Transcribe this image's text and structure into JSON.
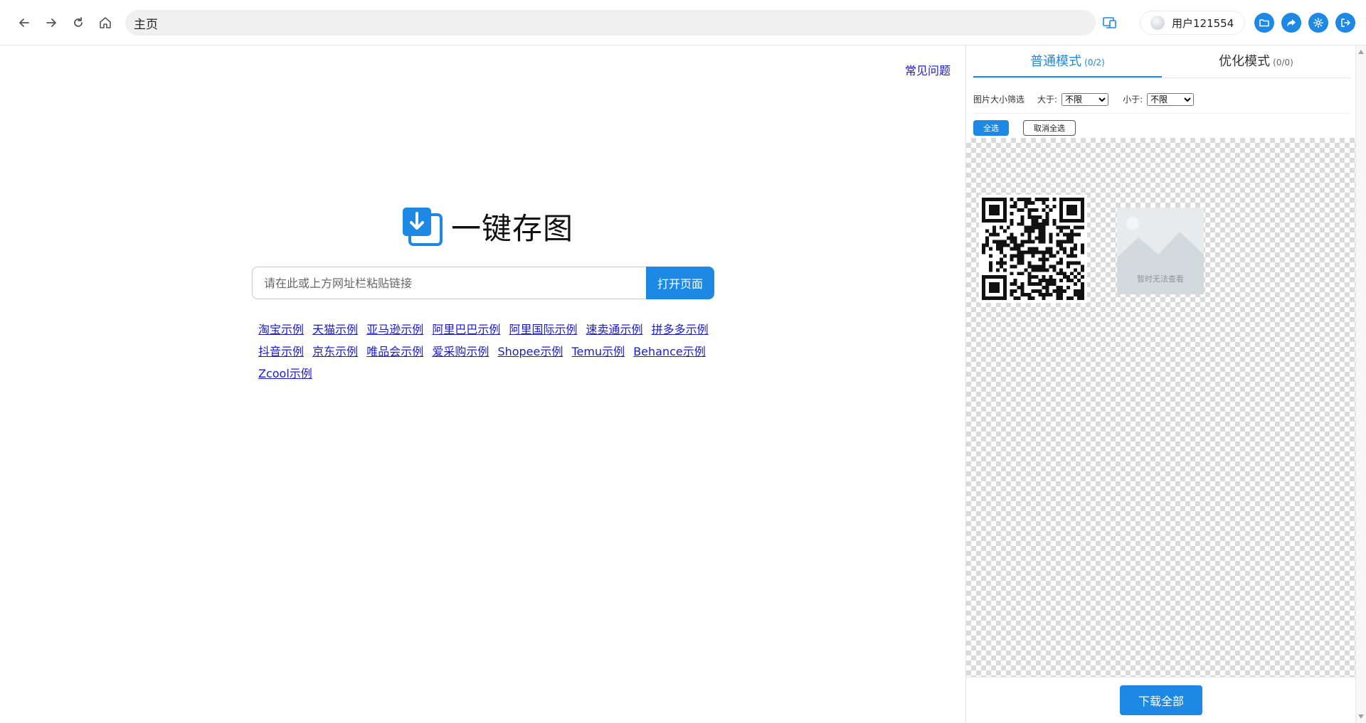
{
  "toolbar": {
    "address_text": "主页",
    "user_name": "用户121554",
    "icons": {
      "back": "arrow-left-icon",
      "forward": "arrow-right-icon",
      "reload": "reload-icon",
      "home": "home-icon",
      "screen": "screen-switch-icon",
      "folder": "folder-icon",
      "share": "share-icon",
      "settings": "gear-icon",
      "logout": "logout-icon"
    },
    "accent_color": "#1e88e5"
  },
  "main": {
    "faq_link": "常见问题",
    "logo_text": "一键存图",
    "search": {
      "placeholder": "请在此或上方网址栏粘贴链接",
      "value": "",
      "button": "打开页面"
    },
    "examples": [
      "淘宝示例",
      "天猫示例",
      "亚马逊示例",
      "阿里巴巴示例",
      "阿里国际示例",
      "速卖通示例",
      "拼多多示例",
      "抖音示例",
      "京东示例",
      "唯品会示例",
      "爱采购示例",
      "Shopee示例",
      "Temu示例",
      "Behance示例",
      "Zcool示例"
    ]
  },
  "panel": {
    "tabs": [
      {
        "label": "普通模式",
        "count": "(0/2)",
        "active": true
      },
      {
        "label": "优化模式",
        "count": "(0/0)",
        "active": false
      }
    ],
    "filter": {
      "label": "图片大小筛选",
      "min_label": "大于:",
      "min_value": "不限",
      "max_label": "小于:",
      "max_value": "不限"
    },
    "select_all": "全选",
    "deselect_all": "取消全选",
    "placeholder_text": "暂时无法查看",
    "download_all": "下载全部"
  }
}
